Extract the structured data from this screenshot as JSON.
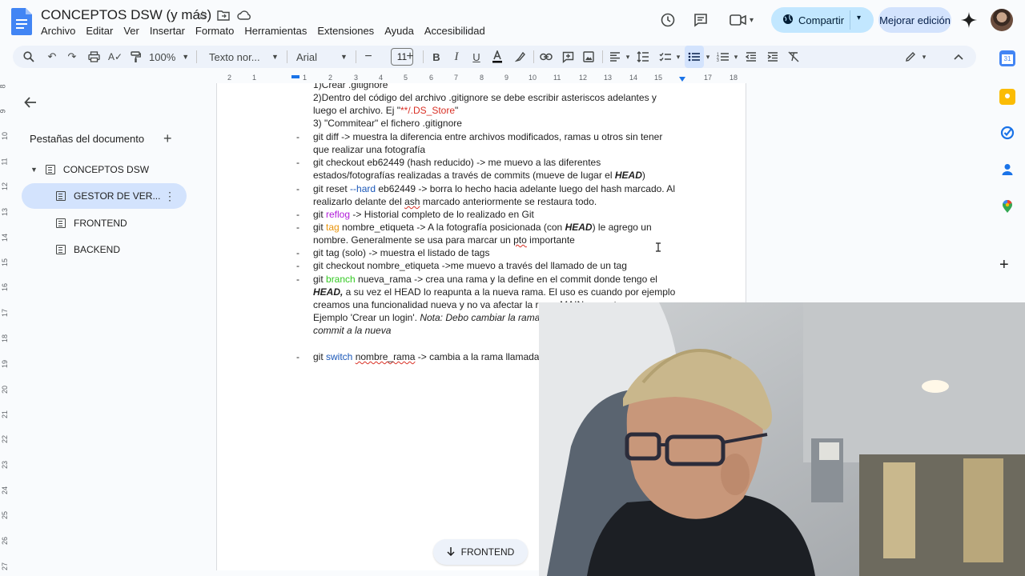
{
  "header": {
    "doc_title": "CONCEPTOS DSW (y más)",
    "menu": [
      "Archivo",
      "Editar",
      "Ver",
      "Insertar",
      "Formato",
      "Herramientas",
      "Extensiones",
      "Ayuda",
      "Accesibilidad"
    ],
    "share_label": "Compartir",
    "improve_label": "Mejorar edición"
  },
  "toolbar": {
    "zoom": "100%",
    "style": "Texto nor...",
    "font": "Arial",
    "font_size": "11"
  },
  "sidebar": {
    "title": "Pestañas del documento",
    "root_tab": "CONCEPTOS DSW",
    "tabs": [
      {
        "label": "GESTOR DE VER..."
      },
      {
        "label": "FRONTEND"
      },
      {
        "label": "BACKEND"
      }
    ]
  },
  "ruler": {
    "h_ticks": [
      "2",
      "1",
      "1",
      "2",
      "3",
      "4",
      "5",
      "6",
      "7",
      "8",
      "9",
      "10",
      "11",
      "12",
      "13",
      "14",
      "15",
      "16",
      "17",
      "18"
    ],
    "v_ticks": [
      "8",
      "9",
      "10",
      "11",
      "12",
      "13",
      "14",
      "15",
      "16",
      "17",
      "18",
      "19",
      "20",
      "21",
      "22",
      "23",
      "24",
      "25",
      "26",
      "27"
    ]
  },
  "document": {
    "l0": "1)Crear .gitignore",
    "l1": "2)Dentro del código del archivo .gitignore se debe escribir asteriscos adelantes y",
    "l2a": "luego el archivo. Ej \"",
    "l2b": "**/.DS_Store",
    "l2c": "\"",
    "l3": "3) \"Commitear\" el fichero .gitignore",
    "l4": "git diff -> muestra la diferencia entre archivos modificados, ramas u otros sin tener",
    "l5": "que realizar una fotografía",
    "l6": "git checkout eb62449 (hash reducido) ->  me muevo a las diferentes",
    "l7a": "estados/fotografías realizadas a través de commits (mueve de lugar el ",
    "l7b": "HEAD",
    "l7c": ")",
    "l8a": "git reset ",
    "l8b": "--hard",
    "l8c": " eb62449 -> borra lo hecho hacia adelante luego del hash marcado. Al",
    "l9a": "realizarlo delante del ",
    "l9b": "ash",
    "l9c": " marcado anteriormente se restaura todo.",
    "l10a": "git ",
    "l10b": "reflog",
    "l10c": " -> Historial completo de lo realizado en Git",
    "l11a": "git ",
    "l11b": "tag",
    "l11c": " nombre_etiqueta -> A la fotografía posicionada (con ",
    "l11d": "HEAD",
    "l11e": ") le agrego un",
    "l12a": "nombre. Generalmente se usa para marcar un ",
    "l12b": "pto",
    "l12c": " importante",
    "l13": "git tag (solo) -> muestra el listado de tags",
    "l14": "git checkout nombre_etiqueta ->me muevo a través del llamado de un tag",
    "l15a": "git ",
    "l15b": "branch",
    "l15c": " nueva_rama -> crea una rama y la define en el commit donde tengo el",
    "l16a": "HEAD,",
    "l16b": " a su vez el HEAD lo reapunta a la nueva rama. El uso es cuando por ejemplo",
    "l17": "creamos una funcionalidad nueva y no va afectar la rama MAIN para otro uso.",
    "l18a": "Ejemplo 'Crear un login'. ",
    "l18b": "Nota: Debo cambiar la rama",
    "l19": "commit a la nueva",
    "l20a": "git ",
    "l20b": "switch",
    "l20c": " ",
    "l20d": "nombre_rama",
    "l20e": " -> cambia a la rama llamada"
  },
  "chip_label": "FRONTEND"
}
